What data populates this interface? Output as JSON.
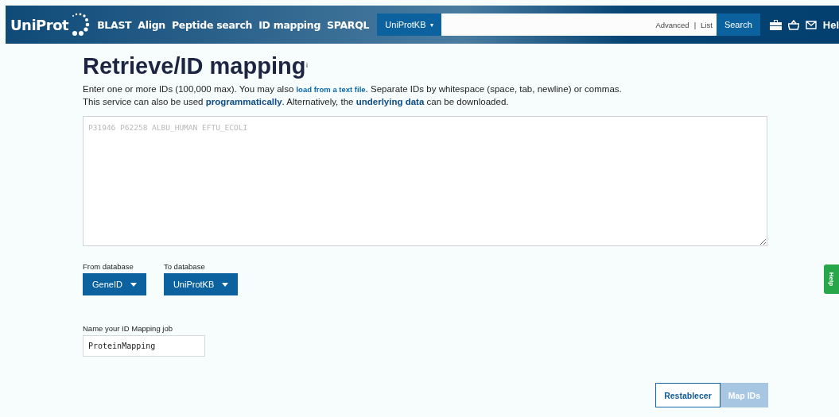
{
  "header": {
    "logo": "UniProt",
    "nav": [
      "BLAST",
      "Align",
      "Peptide search",
      "ID mapping",
      "SPARQL"
    ],
    "search": {
      "database": "UniProtKB",
      "caret": "▾",
      "links": [
        "Advanced",
        "List"
      ],
      "separator": "|",
      "button": "Search"
    },
    "help": "Hel"
  },
  "page": {
    "title": "Retrieve/ID mapping",
    "lines": [
      [
        {
          "text": "Enter one or more IDs (100,000 max). You may also "
        },
        {
          "text": "load from a text file",
          "kind": "link"
        },
        {
          "text": ". Separate IDs by whitespace (space, tab, newline) or commas."
        }
      ],
      [
        {
          "text": "This service can also be used "
        },
        {
          "text": "programmatically",
          "kind": "stronglink"
        },
        {
          "text": ". Alternatively, the "
        },
        {
          "text": "underlying data",
          "kind": "stronglink"
        },
        {
          "text": " can be downloaded."
        }
      ]
    ],
    "ids": {
      "placeholder": "P31946 P62258 ALBU_HUMAN EFTU_ECOLI"
    },
    "from": {
      "label": "From database",
      "value": "GeneID"
    },
    "to": {
      "label": "To database",
      "value": "UniProtKB"
    },
    "job": {
      "label": "Name your ID Mapping job",
      "value": "ProteinMapping"
    },
    "buttons": [
      {
        "label": "Restablecer",
        "disabled": false,
        "kind": "secondary"
      },
      {
        "label": "Map IDs",
        "disabled": true,
        "kind": "primary"
      }
    ]
  },
  "help_tab": "Help"
}
